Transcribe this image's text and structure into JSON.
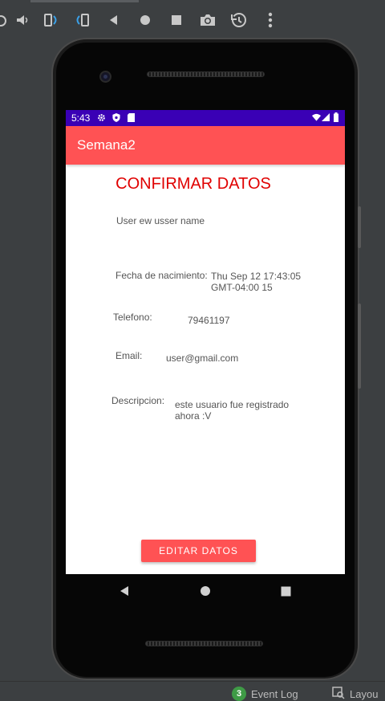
{
  "app": {
    "title": "Semana2",
    "status_time": "5:43"
  },
  "screen": {
    "heading": "CONFIRMAR DATOS",
    "username": "User ew usser name",
    "fields": [
      {
        "label": "Fecha de nacimiento:",
        "value_line1": "Thu Sep 12 17:43:05",
        "value_line2": "GMT-04:00 15"
      },
      {
        "label": "Telefono:",
        "value": "79461197"
      },
      {
        "label": "Email:",
        "value": "user@gmail.com"
      },
      {
        "label": "Descripcion:",
        "value_line1": "este usuario fue registrado",
        "value_line2": "ahora :V"
      }
    ],
    "edit_button": "EDITAR DATOS"
  },
  "ide": {
    "event_log_count": "3",
    "event_log_label": "Event Log",
    "layout_label": "Layou"
  },
  "icons": {
    "toolbar": [
      "power-icon",
      "volume-icon",
      "rotate-left-icon",
      "rotate-right-icon",
      "back-icon",
      "home-icon",
      "overview-icon",
      "camera-icon",
      "history-icon",
      "more-icon"
    ],
    "status": [
      "settings-icon",
      "shield-icon",
      "sd-card-icon",
      "wifi-icon",
      "signal-icon",
      "battery-icon"
    ]
  },
  "colors": {
    "app_bar": "#ff5254",
    "status_bar": "#3a00b5",
    "heading": "#e00000",
    "badge": "#3f9b46"
  }
}
